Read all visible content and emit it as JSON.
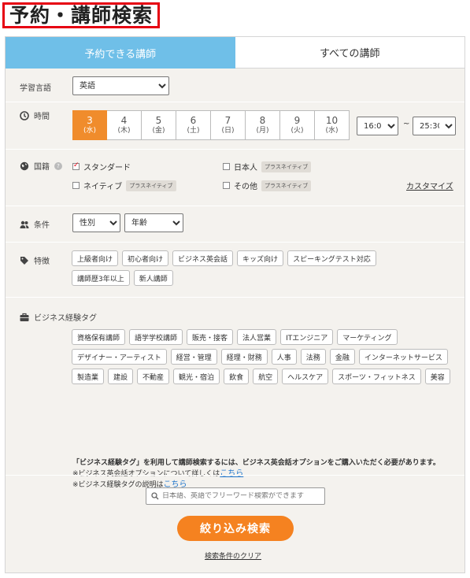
{
  "page_title": "予約・講師検索",
  "tabs": [
    {
      "label": "予約できる講師",
      "active": true
    },
    {
      "label": "すべての講師",
      "active": false
    }
  ],
  "language": {
    "label": "学習言語",
    "selected": "英語"
  },
  "time": {
    "label": "時間",
    "dates": [
      {
        "day": "3",
        "weekday": "(水)",
        "active": true
      },
      {
        "day": "4",
        "weekday": "(木)"
      },
      {
        "day": "5",
        "weekday": "(金)"
      },
      {
        "day": "6",
        "weekday": "(土)"
      },
      {
        "day": "7",
        "weekday": "(日)"
      },
      {
        "day": "8",
        "weekday": "(月)"
      },
      {
        "day": "9",
        "weekday": "(火)"
      },
      {
        "day": "10",
        "weekday": "(水)"
      }
    ],
    "from": "16:00",
    "tilde": "~",
    "to": "25:30"
  },
  "nationality": {
    "label": "国籍",
    "standard": "スタンダード",
    "japanese": "日本人",
    "native": "ネイティブ",
    "other": "その他",
    "plus_native": "プラスネイティブ",
    "customize": "カスタマイズ"
  },
  "conditions": {
    "label": "条件",
    "gender": "性別",
    "age": "年齢"
  },
  "features": {
    "label": "特徴",
    "tags": [
      "上級者向け",
      "初心者向け",
      "ビジネス英会話",
      "キッズ向け",
      "スピーキングテスト対応",
      "講師歴3年以上",
      "新人講師"
    ]
  },
  "business": {
    "label": "ビジネス経験タグ",
    "tags": [
      "資格保有講師",
      "語学学校講師",
      "販売・接客",
      "法人営業",
      "ITエンジニア",
      "マーケティング",
      "デザイナー・アーティスト",
      "経営・管理",
      "経理・財務",
      "人事",
      "法務",
      "金融",
      "インターネットサービス",
      "製造業",
      "建設",
      "不動産",
      "観光・宿泊",
      "飲食",
      "航空",
      "ヘルスケア",
      "スポーツ・フィットネス",
      "美容"
    ],
    "notice_bold": "「ビジネス経験タグ」を利用して講師検索するには、ビジネス英会話オプションをご購入いただく必要があります。",
    "notice_line1_prefix": "※ビジネス英会話オプションについて詳しくは",
    "notice_line2_prefix": "※ビジネス経験タグの説明は",
    "link_text": "こちら"
  },
  "search": {
    "placeholder": "日本語、英語でフリーワード検索ができます"
  },
  "submit_label": "絞り込み検索",
  "clear_label": "検索条件のクリア",
  "colors": {
    "accent": "#f58220",
    "tab_active": "#6fbfe8",
    "title_border": "#e60012"
  }
}
